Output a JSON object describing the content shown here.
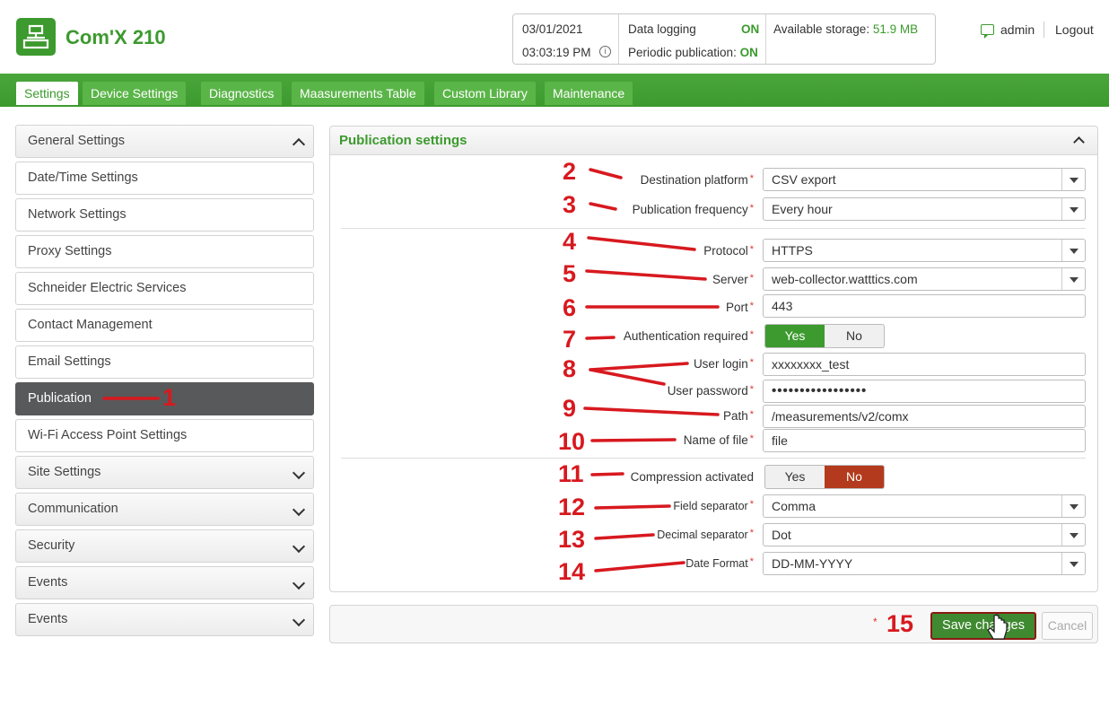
{
  "app": {
    "title": "Com'X 210"
  },
  "status": {
    "date": "03/01/2021",
    "time": "03:03:19 PM",
    "data_logging_label": "Data logging",
    "data_logging_value": "ON",
    "periodic_label": "Periodic publication:",
    "periodic_value": "ON",
    "storage_label": "Available storage:",
    "storage_value": "51.9 MB"
  },
  "user": {
    "name": "admin",
    "logout": "Logout"
  },
  "tabs": [
    {
      "label": "Settings",
      "active": true
    },
    {
      "label": "Device Settings"
    },
    {
      "label": "Diagnostics"
    },
    {
      "label": "Maasurements Table"
    },
    {
      "label": "Custom Library"
    },
    {
      "label": "Maintenance"
    }
  ],
  "sidebar": {
    "items": [
      {
        "label": "General Settings"
      },
      {
        "label": "Date/Time Settings"
      },
      {
        "label": "Network Settings"
      },
      {
        "label": "Proxy Settings"
      },
      {
        "label": "Schneider Electric Services"
      },
      {
        "label": "Contact Management"
      },
      {
        "label": "Email Settings"
      },
      {
        "label": "Publication"
      },
      {
        "label": "Wi-Fi Access Point Settings"
      },
      {
        "label": "Site Settings"
      },
      {
        "label": "Communication"
      },
      {
        "label": "Security"
      },
      {
        "label": "Events"
      },
      {
        "label": "Events"
      }
    ]
  },
  "panel": {
    "title": "Publication settings",
    "fields": {
      "destination": {
        "label": "Destination platform",
        "value": "CSV export"
      },
      "frequency": {
        "label": "Publication frequency",
        "value": "Every hour"
      },
      "protocol": {
        "label": "Protocol",
        "value": "HTTPS"
      },
      "server": {
        "label": "Server",
        "value": "web-collector.watttics.com"
      },
      "port": {
        "label": "Port",
        "value": "443"
      },
      "auth": {
        "label": "Authentication required",
        "yes": "Yes",
        "no": "No",
        "selected": "Yes"
      },
      "login": {
        "label": "User login",
        "value": "xxxxxxxx_test"
      },
      "password": {
        "label": "User password",
        "value": "•••••••••••••••••"
      },
      "path": {
        "label": "Path",
        "value": "/measurements/v2/comx"
      },
      "filename": {
        "label": "Name of file",
        "value": "file"
      },
      "compression": {
        "label": "Compression activated",
        "yes": "Yes",
        "no": "No",
        "selected": "No"
      },
      "field_sep": {
        "label": "Field separator",
        "value": "Comma"
      },
      "decimal_sep": {
        "label": "Decimal separator",
        "value": "Dot"
      },
      "date_format": {
        "label": "Date Format",
        "value": "DD-MM-YYYY"
      }
    }
  },
  "footer": {
    "save": "Save changes",
    "cancel": "Cancel"
  },
  "annotations": [
    "1",
    "2",
    "3",
    "4",
    "5",
    "6",
    "7",
    "8",
    "9",
    "10",
    "11",
    "12",
    "13",
    "14",
    "15"
  ],
  "colors": {
    "brand_green": "#3c9a2e",
    "annotation_red": "#d7191f",
    "toggle_no_active": "#b33a1c",
    "sidebar_active": "#58595b"
  }
}
